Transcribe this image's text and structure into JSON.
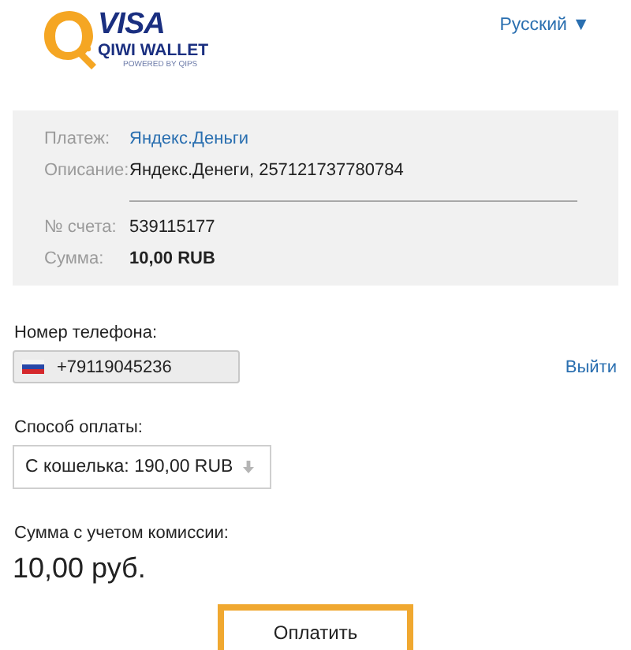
{
  "header": {
    "logo": {
      "brand": "VISA",
      "product": "QIWI WALLET",
      "tagline": "POWERED BY QIPS"
    },
    "language": "Русский ▼"
  },
  "details": {
    "groups": [
      {
        "rows": [
          {
            "label": "Платеж:",
            "value": "Яндекс.Деньги",
            "kind": "link"
          },
          {
            "label": "Описание:",
            "value": "Яндекс.Денеги, 257121737780784",
            "kind": "text"
          }
        ]
      },
      {
        "rows": [
          {
            "label": "№ счета:",
            "value": "539115177",
            "kind": "text"
          },
          {
            "label": "Сумма:",
            "value": "10,00 RUB",
            "kind": "bold"
          }
        ]
      }
    ]
  },
  "phone": {
    "label": "Номер телефона:",
    "value": "+79119045236",
    "logout": "Выйти"
  },
  "payment_method": {
    "label": "Способ оплаты:",
    "value": "С кошелька: 190,00 RUB"
  },
  "total": {
    "label": "Сумма с учетом комиссии:",
    "value": "10,00 руб."
  },
  "pay_button": "Оплатить"
}
